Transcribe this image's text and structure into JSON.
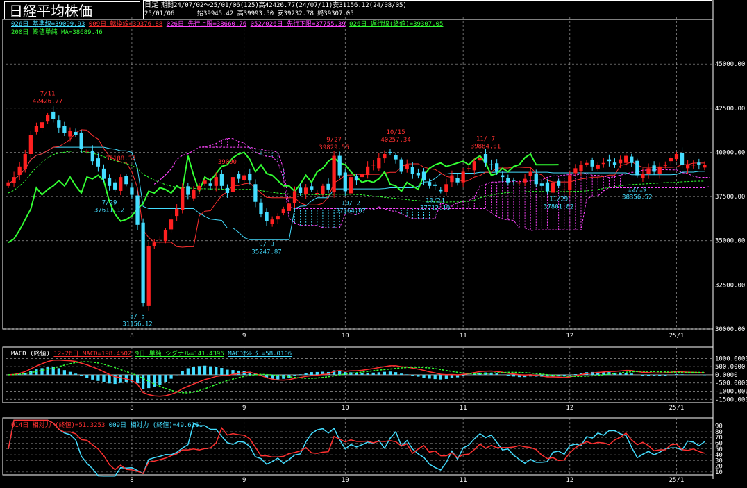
{
  "title": "日経平均株価",
  "header": {
    "period_type": "日足",
    "period_info": "期間24/07/02～25/01/06(125)高42426.77(24/07/11)安31156.12(24/08/05)",
    "last_date": "25/01/06",
    "ohlc": "始39945.42 高39993.50 安39232.78 終39307.05"
  },
  "legend_row1": [
    {
      "text": "026日 基準線=39099.93",
      "color": "#44ddff"
    },
    {
      "text": "009日 転換線=39376.88",
      "color": "#ff3030"
    },
    {
      "text": "026日 先行上限=38660.76",
      "color": "#ff44ff"
    },
    {
      "text": "052/026日 先行下限=37755.39",
      "color": "#ff44ff"
    },
    {
      "text": "026日 遅行線(終値)=39307.05",
      "color": "#33ff33"
    }
  ],
  "legend_row2": [
    {
      "text": "200日 終値単純 MA=38689.46",
      "color": "#33ff33"
    }
  ],
  "macd_legend": [
    {
      "text": "MACD (終値)",
      "color": "#ffffff"
    },
    {
      "text": "12-26日 MACD=198.4502",
      "color": "#ff3030"
    },
    {
      "text": "9日 単純 シグナル=141.4396",
      "color": "#33ff33"
    },
    {
      "text": "MACDｵｼﾚｰﾀｰ=58.0106",
      "color": "#44ddff"
    }
  ],
  "rsi_legend": [
    {
      "text": "014日 相対力 (終値)=51.3253",
      "color": "#ff3030"
    },
    {
      "text": "009日 相対力 (終値)=49.6261",
      "color": "#44ddff"
    }
  ],
  "chart_data": {
    "type": "candlestick",
    "price_axis": {
      "ticks": [
        "45000.00",
        "42500.00",
        "40000.00",
        "37500.00",
        "35000.00",
        "32500.00",
        "30000.00"
      ],
      "ylim": [
        30000,
        46500
      ]
    },
    "macd_axis": {
      "ticks": [
        "1000.0000",
        "500.0000",
        "0.0000",
        "-500.0000",
        "-1000.0000",
        "-1500.0000"
      ],
      "ylim": [
        -1700,
        1100
      ]
    },
    "rsi_axis": {
      "ticks": [
        "90",
        "80",
        "70",
        "60",
        "50",
        "40",
        "30",
        "20",
        "10"
      ],
      "ylim": [
        5,
        92
      ]
    },
    "month_labels": [
      {
        "label": "8",
        "day": 22
      },
      {
        "label": "9",
        "day": 42
      },
      {
        "label": "10",
        "day": 60
      },
      {
        "label": "11",
        "day": 81
      },
      {
        "label": "12",
        "day": 100
      },
      {
        "label": "25/1",
        "day": 119
      }
    ],
    "days": 125,
    "annotations": [
      {
        "label": "7/11",
        "value": "42426.77",
        "day": 7,
        "price": 42426.77,
        "pos": "above",
        "color": "#ff3030"
      },
      {
        "label": "8/ 5",
        "value": "31156.12",
        "day": 23,
        "price": 31156.12,
        "pos": "below",
        "color": "#44ddff"
      },
      {
        "label": "9/ 9",
        "value": "35247.87",
        "day": 46,
        "price": 35247.87,
        "pos": "below",
        "color": "#44ddff"
      },
      {
        "label": "9/27",
        "value": "39829.56",
        "day": 58,
        "price": 39829.56,
        "pos": "above",
        "color": "#ff3030"
      },
      {
        "label": "10/ 2",
        "value": "37564.07",
        "day": 61,
        "price": 37564.07,
        "pos": "below",
        "color": "#44ddff"
      },
      {
        "label": "10/15",
        "value": "40257.34",
        "day": 69,
        "price": 40257.34,
        "pos": "above",
        "color": "#ff3030"
      },
      {
        "label": "10/24",
        "value": "37712.19",
        "day": 76,
        "price": 37712.19,
        "pos": "below",
        "color": "#44ddff"
      },
      {
        "label": "11/ 7",
        "value": "39884.01",
        "day": 85,
        "price": 39884.01,
        "pos": "above",
        "color": "#ff3030"
      },
      {
        "label": "11/29",
        "value": "37801.82",
        "day": 98,
        "price": 37801.82,
        "pos": "below",
        "color": "#44ddff"
      },
      {
        "label": "12/19",
        "value": "38356.52",
        "day": 112,
        "price": 38356.52,
        "pos": "below",
        "color": "#44ddff"
      },
      {
        "label": "7/29",
        "value": "37611.12",
        "day": 18,
        "price": 37611.12,
        "pos": "below",
        "color": "#44ddff"
      },
      {
        "label": "",
        "value": "39188.37",
        "day": 20,
        "price": 39188.37,
        "pos": "above",
        "color": "#ff3030"
      },
      {
        "label": "",
        "value": "39000",
        "day": 39,
        "price": 39000,
        "pos": "above",
        "color": "#ff3030"
      }
    ],
    "closes": [
      38300,
      38600,
      39200,
      39900,
      41000,
      41500,
      41700,
      42100,
      41900,
      41400,
      41100,
      41200,
      41000,
      40200,
      40100,
      39500,
      39200,
      38500,
      38100,
      37900,
      38600,
      38200,
      37600,
      35900,
      31460,
      34700,
      34900,
      35100,
      35600,
      36200,
      36800,
      38000,
      37600,
      37900,
      38100,
      38400,
      38100,
      38600,
      38100,
      37700,
      38600,
      38500,
      38700,
      38400,
      37200,
      36500,
      36100,
      36200,
      36400,
      36800,
      37100,
      37800,
      37700,
      38000,
      37900,
      37700,
      38100,
      37900,
      39800,
      38700,
      37800,
      38600,
      38400,
      38800,
      39200,
      39300,
      39700,
      39900,
      40000,
      39600,
      38900,
      39300,
      38800,
      38700,
      38400,
      38100,
      38100,
      37800,
      38200,
      38700,
      38300,
      38900,
      39100,
      39500,
      39700,
      39400,
      39300,
      38900,
      38600,
      38300,
      38400,
      38300,
      38500,
      38900,
      38200,
      38100,
      37800,
      38300,
      38100,
      37900,
      38700,
      39100,
      39300,
      39400,
      39200,
      39300,
      39400,
      39500,
      39300,
      39600,
      39800,
      39400,
      38700,
      38800,
      39100,
      38900,
      39200,
      39300,
      39700,
      39900,
      39300,
      39300,
      39300,
      39300,
      39307
    ]
  }
}
